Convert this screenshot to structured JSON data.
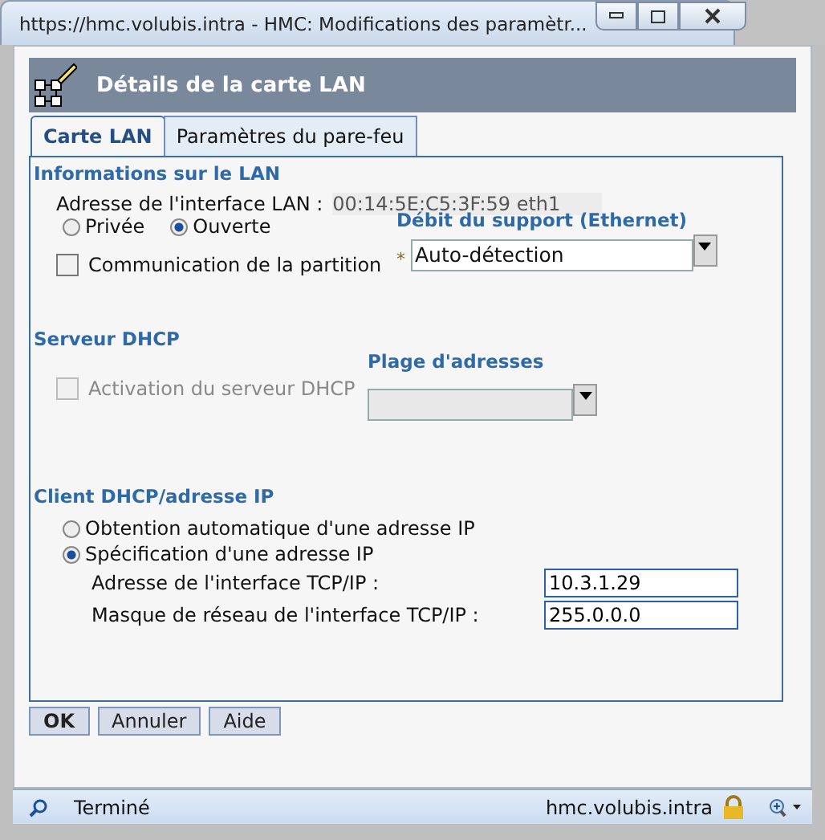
{
  "window": {
    "title": "https://hmc.volubis.intra - HMC: Modifications des paramètr..."
  },
  "dialog": {
    "title": "Détails de la carte LAN"
  },
  "tabs": [
    {
      "label": "Carte LAN",
      "selected": true
    },
    {
      "label": "Paramètres du pare-feu",
      "selected": false
    }
  ],
  "lan": {
    "heading": "Informations sur le LAN",
    "address_label": "Adresse de l'interface LAN :",
    "address_value": "00:14:5E:C5:3F:59 eth1",
    "mode_options": [
      {
        "label": "Privée",
        "selected": false
      },
      {
        "label": "Ouverte",
        "selected": true
      }
    ],
    "partition_comm": {
      "label": "Communication de la partition",
      "checked": false
    },
    "speed": {
      "label": "Débit du support (Ethernet)",
      "required_mark": "*",
      "value": "Auto-détection"
    }
  },
  "dhcp_server": {
    "heading": "Serveur DHCP",
    "enable": {
      "label": "Activation du serveur DHCP",
      "checked": false,
      "disabled": true
    },
    "range": {
      "label": "Plage d'adresses",
      "disabled": true
    }
  },
  "dhcp_client": {
    "heading": "Client DHCP/adresse IP",
    "options": [
      {
        "label": "Obtention automatique d'une adresse IP",
        "selected": false
      },
      {
        "label": "Spécification d'une adresse IP",
        "selected": true
      }
    ],
    "fields": [
      {
        "label": "Adresse de l'interface TCP/IP :",
        "value": "10.3.1.29"
      },
      {
        "label": "Masque de réseau de l'interface TCP/IP :",
        "value": "255.0.0.0"
      }
    ]
  },
  "buttons": [
    {
      "label": "OK",
      "default": true
    },
    {
      "label": "Annuler",
      "default": false
    },
    {
      "label": "Aide",
      "default": false
    }
  ],
  "status_bar": {
    "status": "Terminé",
    "host": "hmc.volubis.intra"
  }
}
